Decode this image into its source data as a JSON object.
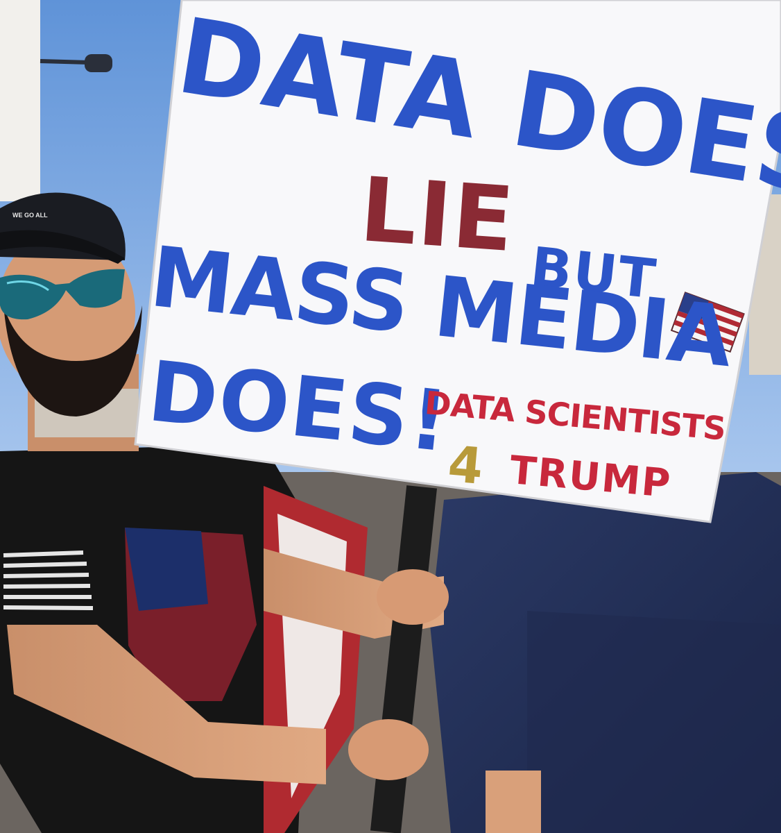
{
  "sign": {
    "line1": "DATA DOESN'T",
    "line2": "LIE",
    "line3": "BUT",
    "line4": "MASS MEDIA",
    "line5": "DOES!",
    "credit_line1": "DATA SCIENTISTS",
    "credit_4": "4",
    "credit_line2": "TRUMP"
  },
  "cap_text": "WE GO ALL",
  "colors": {
    "sky": "#7aa6e0",
    "sign_blue": "#2c55c8",
    "sign_red": "#c8283c",
    "sign_maroon": "#8a2a34",
    "sign_gold": "#b89a3a"
  }
}
